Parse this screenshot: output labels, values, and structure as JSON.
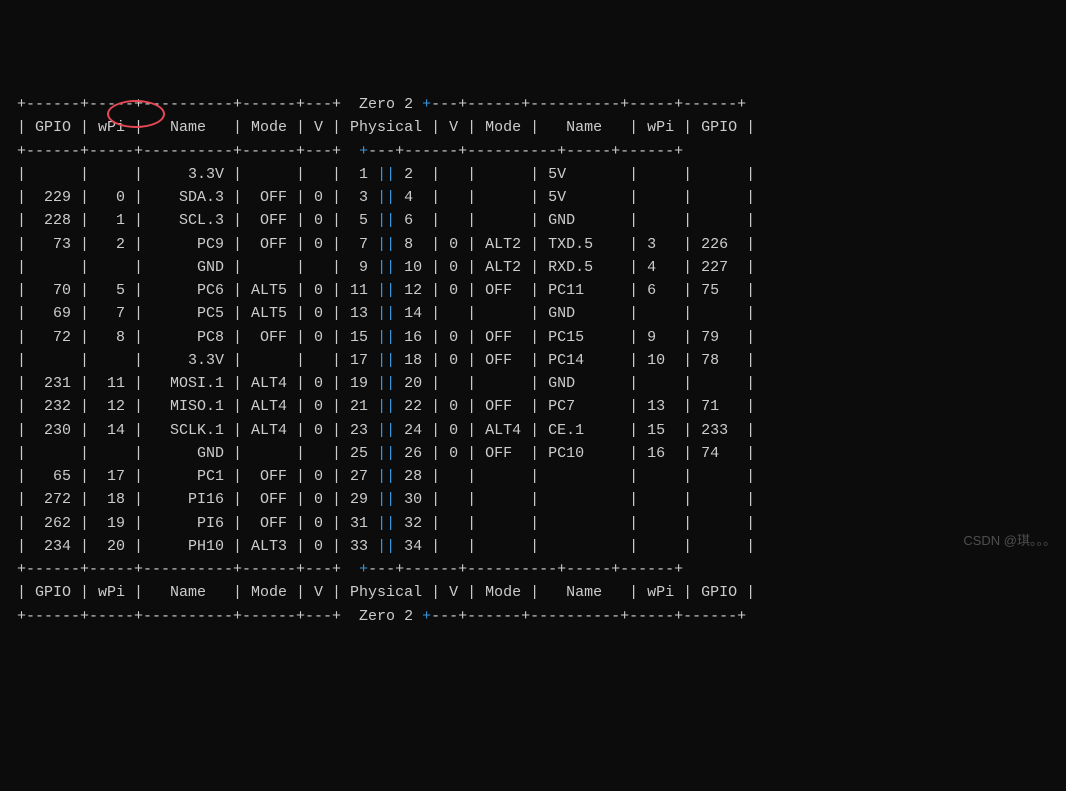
{
  "board_name": "Zero 2",
  "headers": [
    "GPIO",
    "wPi",
    "Name",
    "Mode",
    "V",
    "Physical",
    "V",
    "Mode",
    "Name",
    "wPi",
    "GPIO"
  ],
  "watermark": "CSDN @琪。。。",
  "rows": [
    {
      "l": {
        "gpio": "",
        "wpi": "",
        "name": "3.3V",
        "mode": "",
        "v": ""
      },
      "p": [
        1,
        2
      ],
      "r": {
        "v": "",
        "mode": "",
        "name": "5V",
        "wpi": "",
        "gpio": ""
      }
    },
    {
      "l": {
        "gpio": "229",
        "wpi": "0",
        "name": "SDA.3",
        "mode": "OFF",
        "v": "0"
      },
      "p": [
        3,
        4
      ],
      "r": {
        "v": "",
        "mode": "",
        "name": "5V",
        "wpi": "",
        "gpio": ""
      }
    },
    {
      "l": {
        "gpio": "228",
        "wpi": "1",
        "name": "SCL.3",
        "mode": "OFF",
        "v": "0"
      },
      "p": [
        5,
        6
      ],
      "r": {
        "v": "",
        "mode": "",
        "name": "GND",
        "wpi": "",
        "gpio": ""
      }
    },
    {
      "l": {
        "gpio": "73",
        "wpi": "2",
        "name": "PC9",
        "mode": "OFF",
        "v": "0"
      },
      "p": [
        7,
        8
      ],
      "r": {
        "v": "0",
        "mode": "ALT2",
        "name": "TXD.5",
        "wpi": "3",
        "gpio": "226"
      }
    },
    {
      "l": {
        "gpio": "",
        "wpi": "",
        "name": "GND",
        "mode": "",
        "v": ""
      },
      "p": [
        9,
        10
      ],
      "r": {
        "v": "0",
        "mode": "ALT2",
        "name": "RXD.5",
        "wpi": "4",
        "gpio": "227"
      }
    },
    {
      "l": {
        "gpio": "70",
        "wpi": "5",
        "name": "PC6",
        "mode": "ALT5",
        "v": "0"
      },
      "p": [
        11,
        12
      ],
      "r": {
        "v": "0",
        "mode": "OFF",
        "name": "PC11",
        "wpi": "6",
        "gpio": "75"
      }
    },
    {
      "l": {
        "gpio": "69",
        "wpi": "7",
        "name": "PC5",
        "mode": "ALT5",
        "v": "0"
      },
      "p": [
        13,
        14
      ],
      "r": {
        "v": "",
        "mode": "",
        "name": "GND",
        "wpi": "",
        "gpio": ""
      }
    },
    {
      "l": {
        "gpio": "72",
        "wpi": "8",
        "name": "PC8",
        "mode": "OFF",
        "v": "0"
      },
      "p": [
        15,
        16
      ],
      "r": {
        "v": "0",
        "mode": "OFF",
        "name": "PC15",
        "wpi": "9",
        "gpio": "79"
      }
    },
    {
      "l": {
        "gpio": "",
        "wpi": "",
        "name": "3.3V",
        "mode": "",
        "v": ""
      },
      "p": [
        17,
        18
      ],
      "r": {
        "v": "0",
        "mode": "OFF",
        "name": "PC14",
        "wpi": "10",
        "gpio": "78"
      }
    },
    {
      "l": {
        "gpio": "231",
        "wpi": "11",
        "name": "MOSI.1",
        "mode": "ALT4",
        "v": "0"
      },
      "p": [
        19,
        20
      ],
      "r": {
        "v": "",
        "mode": "",
        "name": "GND",
        "wpi": "",
        "gpio": ""
      }
    },
    {
      "l": {
        "gpio": "232",
        "wpi": "12",
        "name": "MISO.1",
        "mode": "ALT4",
        "v": "0"
      },
      "p": [
        21,
        22
      ],
      "r": {
        "v": "0",
        "mode": "OFF",
        "name": "PC7",
        "wpi": "13",
        "gpio": "71"
      }
    },
    {
      "l": {
        "gpio": "230",
        "wpi": "14",
        "name": "SCLK.1",
        "mode": "ALT4",
        "v": "0"
      },
      "p": [
        23,
        24
      ],
      "r": {
        "v": "0",
        "mode": "ALT4",
        "name": "CE.1",
        "wpi": "15",
        "gpio": "233"
      }
    },
    {
      "l": {
        "gpio": "",
        "wpi": "",
        "name": "GND",
        "mode": "",
        "v": ""
      },
      "p": [
        25,
        26
      ],
      "r": {
        "v": "0",
        "mode": "OFF",
        "name": "PC10",
        "wpi": "16",
        "gpio": "74"
      }
    },
    {
      "l": {
        "gpio": "65",
        "wpi": "17",
        "name": "PC1",
        "mode": "OFF",
        "v": "0"
      },
      "p": [
        27,
        28
      ],
      "r": {
        "v": "",
        "mode": "",
        "name": "",
        "wpi": "",
        "gpio": ""
      }
    },
    {
      "l": {
        "gpio": "272",
        "wpi": "18",
        "name": "PI16",
        "mode": "OFF",
        "v": "0"
      },
      "p": [
        29,
        30
      ],
      "r": {
        "v": "",
        "mode": "",
        "name": "",
        "wpi": "",
        "gpio": ""
      }
    },
    {
      "l": {
        "gpio": "262",
        "wpi": "19",
        "name": "PI6",
        "mode": "OFF",
        "v": "0"
      },
      "p": [
        31,
        32
      ],
      "r": {
        "v": "",
        "mode": "",
        "name": "",
        "wpi": "",
        "gpio": ""
      }
    },
    {
      "l": {
        "gpio": "234",
        "wpi": "20",
        "name": "PH10",
        "mode": "ALT3",
        "v": "0"
      },
      "p": [
        33,
        34
      ],
      "r": {
        "v": "",
        "mode": "",
        "name": "",
        "wpi": "",
        "gpio": ""
      }
    }
  ]
}
